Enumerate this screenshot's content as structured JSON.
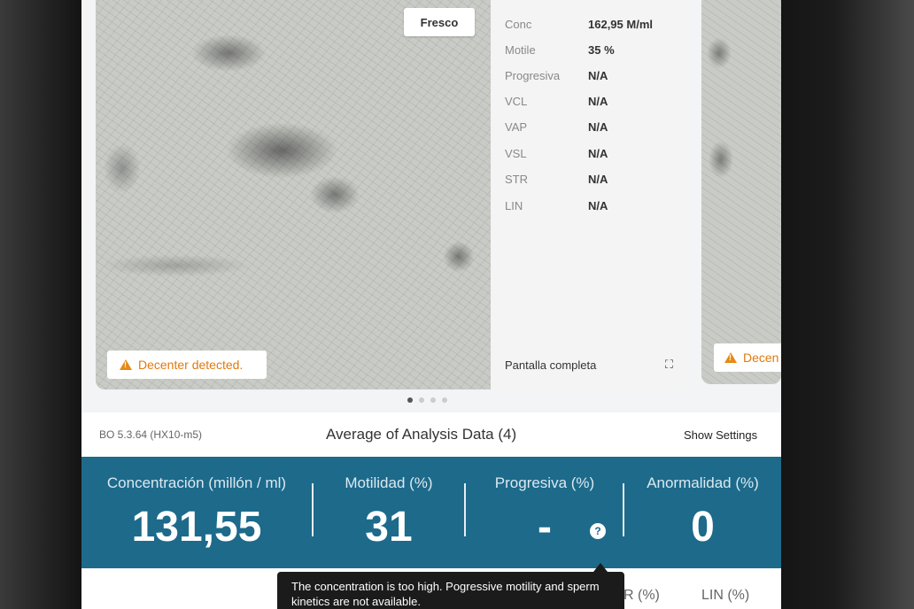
{
  "carousel": {
    "mode_badge": "Fresco",
    "warning": "Decenter detected.",
    "peek_warning": "Decen",
    "stats": [
      {
        "label": "Conc",
        "value": "162,95 M/ml"
      },
      {
        "label": "Motile",
        "value": "35 %"
      },
      {
        "label": "Progresiva",
        "value": "N/A"
      },
      {
        "label": "VCL",
        "value": "N/A"
      },
      {
        "label": "VAP",
        "value": "N/A"
      },
      {
        "label": "VSL",
        "value": "N/A"
      },
      {
        "label": "STR",
        "value": "N/A"
      },
      {
        "label": "LIN",
        "value": "N/A"
      }
    ],
    "fullscreen_label": "Pantalla completa",
    "page_count": 4,
    "active_page": 1
  },
  "summary": {
    "version": "BO 5.3.64 (HX10-m5)",
    "title": "Average of Analysis Data (4)",
    "settings_label": "Show Settings"
  },
  "metrics": [
    {
      "label": "Concentración (millón / ml)",
      "value": "131,55"
    },
    {
      "label": "Motilidad (%)",
      "value": "31"
    },
    {
      "label": "Progresiva (%)",
      "value": "-"
    },
    {
      "label": "Anormalidad (%)",
      "value": "0"
    }
  ],
  "bottom_labels": [
    "R (%)",
    "LIN (%)"
  ],
  "tooltip": "The concentration is too high. Pogressive motility and sperm kinetics are not available.",
  "colors": {
    "metrics_bg": "#1d6a8b",
    "warning": "#e07a10"
  }
}
